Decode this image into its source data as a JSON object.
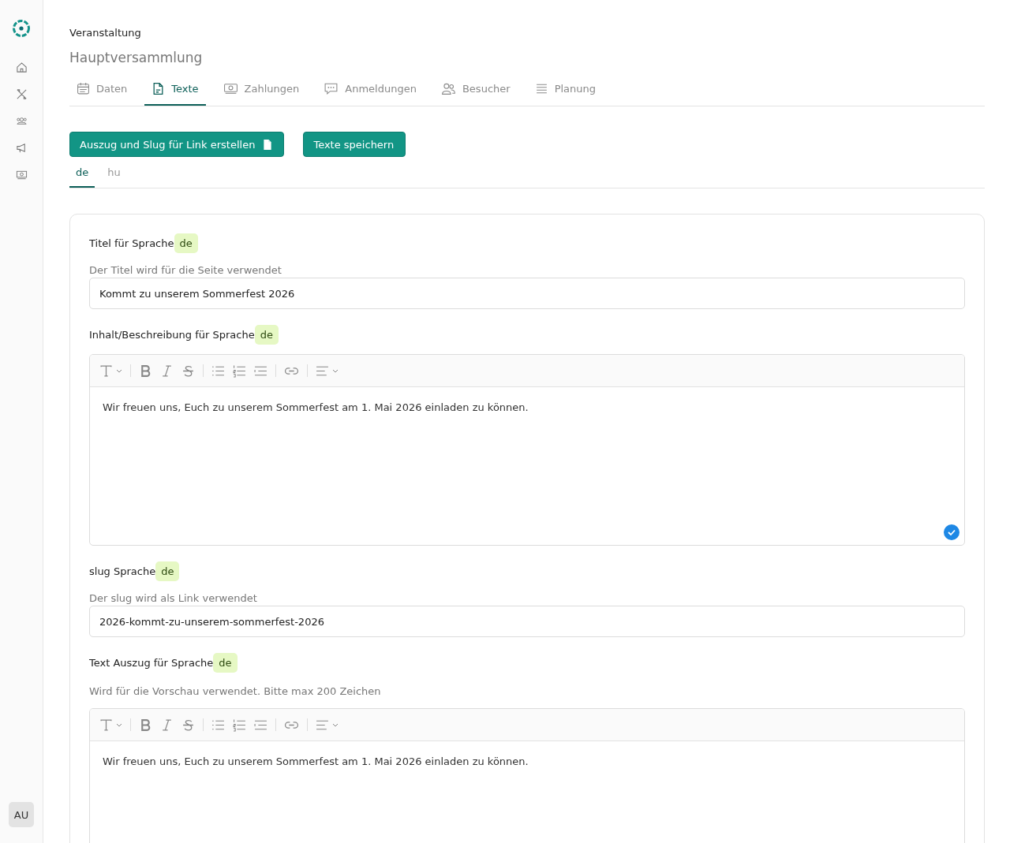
{
  "sidebar": {
    "nav": [
      {
        "kind": "home"
      },
      {
        "kind": "tools"
      },
      {
        "kind": "group"
      },
      {
        "kind": "megaphone"
      },
      {
        "kind": "money"
      }
    ],
    "user_initials": "AU"
  },
  "header": {
    "eyebrow": "Veranstaltung",
    "title": "Hauptversammlung"
  },
  "tabs": [
    {
      "label": "Daten",
      "kind": "calendar",
      "selected": false
    },
    {
      "label": "Texte",
      "kind": "document",
      "selected": true
    },
    {
      "label": "Zahlungen",
      "kind": "money",
      "selected": false
    },
    {
      "label": "Anmeldungen",
      "kind": "chat",
      "selected": false
    },
    {
      "label": "Besucher",
      "kind": "people",
      "selected": false
    },
    {
      "label": "Planung",
      "kind": "lines",
      "selected": false
    }
  ],
  "actions": [
    {
      "label": "Auszug und Slug für Link erstellen",
      "kind": "generate"
    },
    {
      "label": "Texte speichern",
      "kind": "save"
    }
  ],
  "languages": [
    {
      "label": "de",
      "selected": true
    },
    {
      "label": "hu",
      "selected": false
    }
  ],
  "fields": [
    {
      "kind": "input",
      "label": "Titel für Sprache",
      "lang": "de",
      "hint": "Der Titel wird für die Seite verwendet",
      "value": "Kommt zu unserem Sommerfest 2026"
    },
    {
      "kind": "editor",
      "label": "Inhalt/Beschreibung für Sprache",
      "lang": "de",
      "value": "Wir freuen uns, Euch zu unserem Sommerfest am 1. Mai 2026 einladen zu können.",
      "validated": true
    },
    {
      "kind": "input",
      "label": "slug Sprache",
      "lang": "de",
      "hint": "Der slug wird als Link verwendet",
      "value": "2026-kommt-zu-unserem-sommerfest-2026"
    },
    {
      "kind": "editor",
      "label": "Text Auszug für Sprache",
      "lang": "de",
      "hint": "Wird für die Vorschau verwendet. Bitte max 200 Zeichen",
      "value": "Wir freuen uns, Euch zu unserem Sommerfest am 1. Mai 2026 einladen zu können."
    }
  ]
}
